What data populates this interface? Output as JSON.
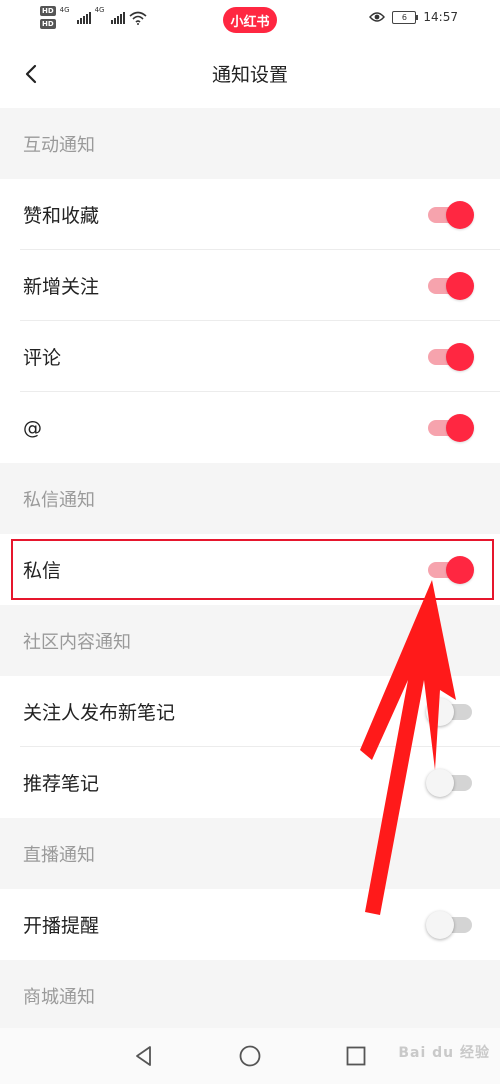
{
  "status_bar": {
    "hd_label": "HD",
    "network_1": "4G",
    "network_2": "4G",
    "app_badge": "小红书",
    "battery": "6",
    "time": "14:57"
  },
  "header": {
    "title": "通知设置"
  },
  "sections": {
    "interaction": {
      "title": "互动通知",
      "items": [
        {
          "label": "赞和收藏",
          "enabled": true
        },
        {
          "label": "新增关注",
          "enabled": true
        },
        {
          "label": "评论",
          "enabled": true
        },
        {
          "label": "@",
          "enabled": true
        }
      ]
    },
    "message": {
      "title": "私信通知",
      "items": [
        {
          "label": "私信",
          "enabled": true
        }
      ]
    },
    "community": {
      "title": "社区内容通知",
      "items": [
        {
          "label": "关注人发布新笔记",
          "enabled": false
        },
        {
          "label": "推荐笔记",
          "enabled": false
        }
      ]
    },
    "live": {
      "title": "直播通知",
      "items": [
        {
          "label": "开播提醒",
          "enabled": false
        }
      ]
    },
    "mall": {
      "title": "商城通知"
    }
  },
  "colors": {
    "accent": "#ff2741",
    "annotation": "#e6162d"
  },
  "watermark": "Bai du 经验",
  "icons": [
    "back-arrow-icon",
    "wifi-icon",
    "eye-icon",
    "nav-back-icon",
    "nav-home-icon",
    "nav-recents-icon"
  ]
}
